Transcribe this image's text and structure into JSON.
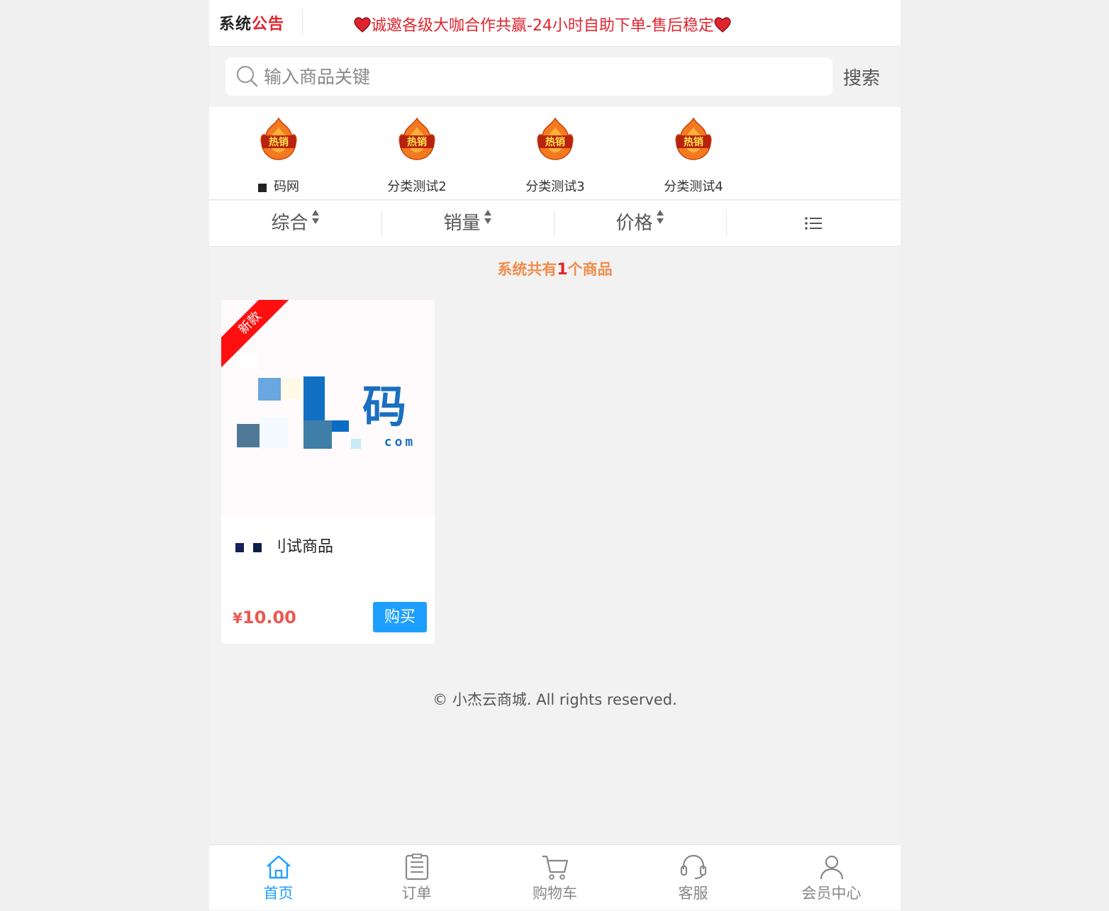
{
  "notice": {
    "logo_part1": "系统",
    "logo_part2": "公告",
    "text": "诚邀各级大咖合作共赢-24小时自助下单-售后稳定"
  },
  "search": {
    "placeholder": "输入商品关键",
    "button_label": "搜索"
  },
  "categories": [
    {
      "badge": "热销",
      "label": "码网"
    },
    {
      "badge": "热销",
      "label": "分类测试2"
    },
    {
      "badge": "热销",
      "label": "分类测试3"
    },
    {
      "badge": "热销",
      "label": "分类测试4"
    }
  ],
  "sort": {
    "items": [
      "综合",
      "销量",
      "价格"
    ],
    "view_icon": "list-icon"
  },
  "count": {
    "prefix": "系统共有",
    "number": "1",
    "suffix": "个商品"
  },
  "products": [
    {
      "ribbon": "新款",
      "image_text": "码",
      "image_subtext": "com",
      "name": "刂试商品",
      "currency": "¥",
      "price": "10.00",
      "buy_label": "购买"
    }
  ],
  "footer": {
    "copyright": "© 小杰云商城. All rights reserved."
  },
  "tabbar": {
    "items": [
      {
        "label": "首页",
        "icon": "home-icon",
        "active": true
      },
      {
        "label": "订单",
        "icon": "orders-icon",
        "active": false
      },
      {
        "label": "购物车",
        "icon": "cart-icon",
        "active": false
      },
      {
        "label": "客服",
        "icon": "headset-icon",
        "active": false
      },
      {
        "label": "会员中心",
        "icon": "user-icon",
        "active": false
      }
    ]
  },
  "colors": {
    "accent": "#1e9fff",
    "notice_red": "#e0242e",
    "count_orange": "#f08c4a",
    "price_red": "#ea5a50"
  }
}
